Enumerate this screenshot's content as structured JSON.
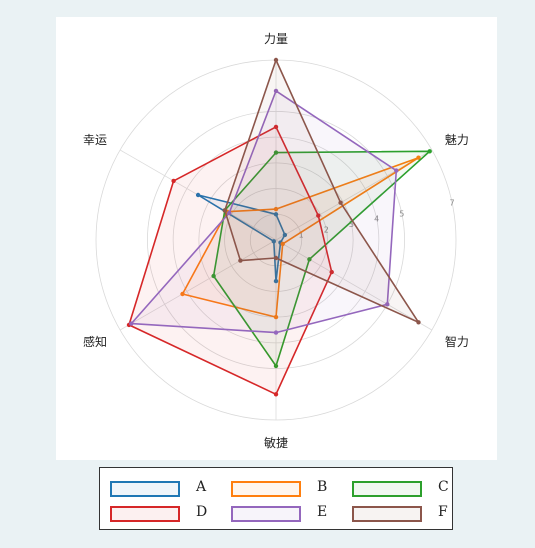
{
  "chart_data": {
    "type": "radar",
    "axes": [
      "力量",
      "魅力",
      "智力",
      "敏捷",
      "感知",
      "幸运"
    ],
    "radial_ticks": [
      "1",
      "2",
      "3",
      "4",
      "5",
      "7"
    ],
    "radial_tick_values": [
      1,
      2,
      3,
      4,
      5,
      7
    ],
    "r_range": [
      0,
      7
    ],
    "grid": true,
    "legend_position": "bottom",
    "series": [
      {
        "name": "A",
        "color": "#1f77b4",
        "values": [
          1.0,
          0.4,
          0.2,
          1.6,
          0.1,
          3.5
        ]
      },
      {
        "name": "B",
        "color": "#ff7f0e",
        "values": [
          1.2,
          6.4,
          0.3,
          3.0,
          4.2,
          2.2
        ]
      },
      {
        "name": "C",
        "color": "#2ca02c",
        "values": [
          3.4,
          6.9,
          1.5,
          4.9,
          2.8,
          2.3
        ]
      },
      {
        "name": "D",
        "color": "#d62728",
        "values": [
          4.4,
          1.9,
          2.5,
          6.0,
          6.6,
          4.6
        ]
      },
      {
        "name": "E",
        "color": "#9467bd",
        "values": [
          5.8,
          5.4,
          5.0,
          3.6,
          6.5,
          2.1
        ]
      },
      {
        "name": "F",
        "color": "#8c564b",
        "values": [
          7.0,
          2.9,
          6.4,
          0.7,
          1.6,
          2.3
        ]
      }
    ]
  }
}
